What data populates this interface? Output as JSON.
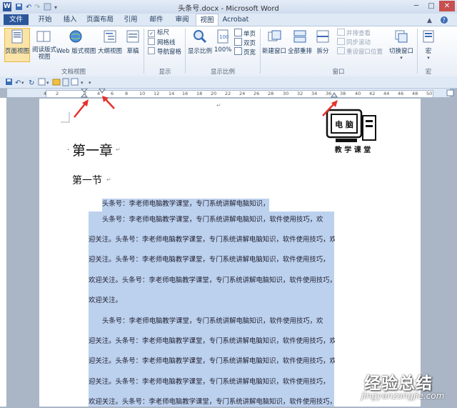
{
  "window": {
    "title": "头条号.docx - Microsoft Word",
    "app_icon": "W",
    "controls": [
      "─",
      "□",
      "✕"
    ]
  },
  "tabs": [
    {
      "label": "文件"
    },
    {
      "label": "开始"
    },
    {
      "label": "插入"
    },
    {
      "label": "页面布局"
    },
    {
      "label": "引用"
    },
    {
      "label": "邮件"
    },
    {
      "label": "审阅"
    },
    {
      "label": "视图"
    },
    {
      "label": "Acrobat"
    }
  ],
  "ribbon": {
    "views": {
      "label": "文档视图",
      "buttons": [
        "页面视图",
        "阅读版式视图",
        "Web 版式视图",
        "大纲视图",
        "草稿"
      ]
    },
    "show": {
      "label": "显示",
      "items": [
        {
          "label": "标尺",
          "checked": true
        },
        {
          "label": "网格线",
          "checked": false
        },
        {
          "label": "导航窗格",
          "checked": false
        }
      ]
    },
    "zoom": {
      "label": "显示比例",
      "buttons": [
        "显示比例",
        "100%"
      ],
      "small": [
        "单页",
        "双页",
        "页宽"
      ]
    },
    "window": {
      "label": "窗口",
      "buttons": [
        "新建窗口",
        "全部重排",
        "拆分"
      ],
      "small": [
        "并排查看",
        "同步滚动",
        "重设窗口位置"
      ],
      "switch": "切换窗口"
    },
    "macro": {
      "label": "宏",
      "button": "宏"
    }
  },
  "ruler": {
    "ticks": [
      "4",
      "2",
      "2",
      "4",
      "6",
      "8",
      "10",
      "12",
      "14",
      "16",
      "18",
      "20",
      "22",
      "24",
      "26",
      "28",
      "30",
      "32",
      "34",
      "36",
      "38",
      "40",
      "42",
      "44",
      "46",
      "48",
      "50"
    ]
  },
  "logo": {
    "screen_text": "电 脑",
    "caption": "教 学 课 堂"
  },
  "document": {
    "heading1": "第一章",
    "heading2": "第一节",
    "lines": [
      "头条号：李老师电脑教学课堂，专门系统讲解电脑知识，",
      "头条号：李老师电脑教学课堂，专门系统讲解电脑知识，软件使用技巧，欢",
      "迎关注。头条号：李老师电脑教学课堂，专门系统讲解电脑知识，软件使用技巧，欢",
      "迎关注。头条号：李老师电脑教学课堂，专门系统讲解电脑知识，软件使用技巧，",
      "欢迎关注。头条号：李老师电脑教学课堂，专门系统讲解电脑知识，软件使用技巧，",
      "欢迎关注。",
      "头条号：李老师电脑教学课堂，专门系统讲解电脑知识，软件使用技巧，欢",
      "迎关注。头条号：李老师电脑教学课堂，专门系统讲解电脑知识，软件使用技巧，欢",
      "迎关注。头条号：李老师电脑教学课堂，专门系统讲解电脑知识，软件使用技巧，欢",
      "迎关注。头条号：李老师电脑教学课堂，专门系统讲解电脑知识，软件使用技巧，",
      "欢迎关注。头条号：李老师电脑教学课堂，专门系统讲解电脑知识，软件使用技巧，"
    ]
  },
  "watermark": {
    "brand": "经验总结",
    "url": "jingyanzongjie.com"
  },
  "colors": {
    "accent": "#2b579a",
    "selection": "#bcd1ee",
    "arrow": "#e5322d"
  }
}
